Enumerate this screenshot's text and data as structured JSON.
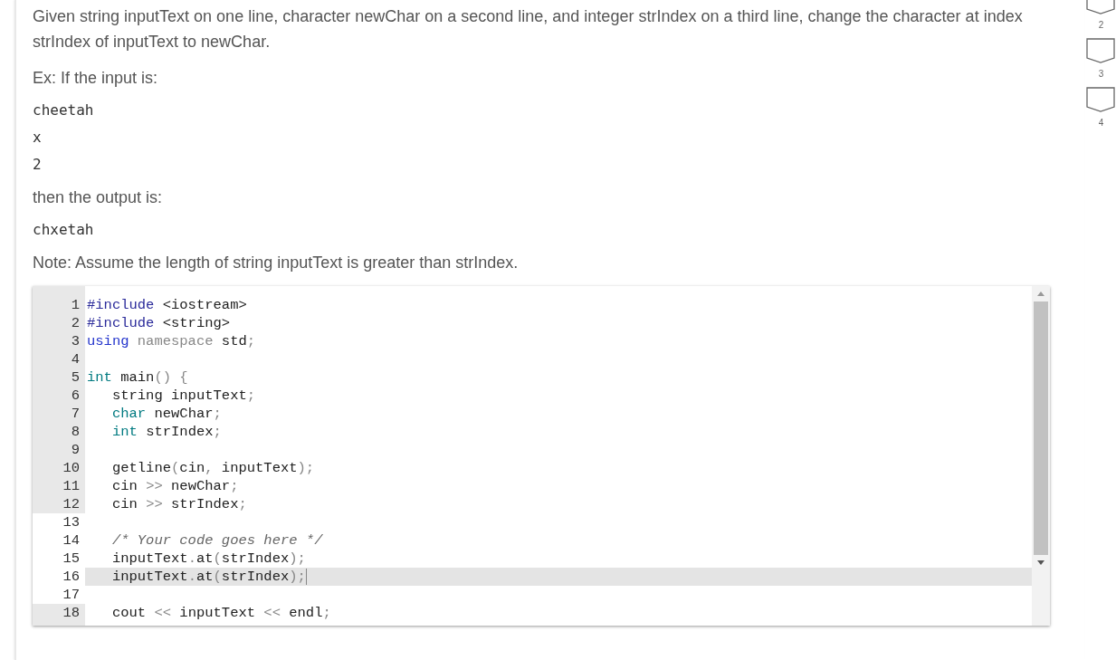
{
  "prompt": {
    "paragraphs": [
      {
        "kind": "text",
        "text": "Given string inputText on one line, character newChar on a second line, and integer strIndex on a third line, change the character at index strIndex of inputText to newChar."
      },
      {
        "kind": "text",
        "text": "Ex: If the input is:"
      },
      {
        "kind": "code",
        "text": "cheetah"
      },
      {
        "kind": "code",
        "text": "x"
      },
      {
        "kind": "code",
        "text": "2"
      },
      {
        "kind": "text",
        "text": "then the output is:"
      },
      {
        "kind": "code",
        "text": "chxetah"
      },
      {
        "kind": "text",
        "text": "Note: Assume the length of string inputText is greater than strIndex."
      }
    ]
  },
  "editor": {
    "lines": [
      {
        "number": "1",
        "read_only": true,
        "active": false,
        "tokens": [
          {
            "kind": "meta",
            "text": "#include "
          },
          {
            "kind": "plain",
            "text": "<iostream>"
          }
        ]
      },
      {
        "number": "2",
        "read_only": true,
        "active": false,
        "tokens": [
          {
            "kind": "meta",
            "text": "#include "
          },
          {
            "kind": "plain",
            "text": "<string>"
          }
        ]
      },
      {
        "number": "3",
        "read_only": true,
        "active": false,
        "tokens": [
          {
            "kind": "keyword",
            "text": "using "
          },
          {
            "kind": "muted",
            "text": "namespace "
          },
          {
            "kind": "plain",
            "text": "std"
          },
          {
            "kind": "punct",
            "text": ";"
          }
        ]
      },
      {
        "number": "4",
        "read_only": true,
        "active": false
      },
      {
        "number": "5",
        "read_only": true,
        "active": false,
        "tokens": [
          {
            "kind": "type",
            "text": "int "
          },
          {
            "kind": "plain",
            "text": "main"
          },
          {
            "kind": "punct",
            "text": "() {"
          }
        ]
      },
      {
        "number": "6",
        "read_only": true,
        "active": false,
        "tokens": [
          {
            "kind": "plain",
            "text": "   string inputText"
          },
          {
            "kind": "punct",
            "text": ";"
          }
        ]
      },
      {
        "number": "7",
        "read_only": true,
        "active": false,
        "tokens": [
          {
            "kind": "type",
            "text": "   char "
          },
          {
            "kind": "plain",
            "text": "newChar"
          },
          {
            "kind": "punct",
            "text": ";"
          }
        ]
      },
      {
        "number": "8",
        "read_only": true,
        "active": false,
        "tokens": [
          {
            "kind": "type",
            "text": "   int "
          },
          {
            "kind": "plain",
            "text": "strIndex"
          },
          {
            "kind": "punct",
            "text": ";"
          }
        ]
      },
      {
        "number": "9",
        "read_only": true,
        "active": false
      },
      {
        "number": "10",
        "read_only": true,
        "active": false,
        "tokens": [
          {
            "kind": "plain",
            "text": "   getline"
          },
          {
            "kind": "punct",
            "text": "("
          },
          {
            "kind": "plain",
            "text": "cin"
          },
          {
            "kind": "punct",
            "text": ", "
          },
          {
            "kind": "plain",
            "text": "inputText"
          },
          {
            "kind": "punct",
            "text": ");"
          }
        ]
      },
      {
        "number": "11",
        "read_only": true,
        "active": false,
        "tokens": [
          {
            "kind": "plain",
            "text": "   cin "
          },
          {
            "kind": "punct",
            "text": ">> "
          },
          {
            "kind": "plain",
            "text": "newChar"
          },
          {
            "kind": "punct",
            "text": ";"
          }
        ]
      },
      {
        "number": "12",
        "read_only": true,
        "active": false,
        "tokens": [
          {
            "kind": "plain",
            "text": "   cin "
          },
          {
            "kind": "punct",
            "text": ">> "
          },
          {
            "kind": "plain",
            "text": "strIndex"
          },
          {
            "kind": "punct",
            "text": ";"
          }
        ]
      },
      {
        "number": "13",
        "read_only": false,
        "active": false
      },
      {
        "number": "14",
        "read_only": false,
        "active": false,
        "tokens": [
          {
            "kind": "comment",
            "text": "   /* Your code goes here */"
          }
        ]
      },
      {
        "number": "15",
        "read_only": false,
        "active": false,
        "tokens": [
          {
            "kind": "plain",
            "text": "   inputText"
          },
          {
            "kind": "punct",
            "text": "."
          },
          {
            "kind": "plain",
            "text": "at"
          },
          {
            "kind": "punct",
            "text": "("
          },
          {
            "kind": "plain",
            "text": "strIndex"
          },
          {
            "kind": "punct",
            "text": ");"
          }
        ]
      },
      {
        "number": "16",
        "read_only": false,
        "active": true,
        "tokens": [
          {
            "kind": "plain",
            "text": "   inputText"
          },
          {
            "kind": "punct",
            "text": "."
          },
          {
            "kind": "plain",
            "text": "at"
          },
          {
            "kind": "punct",
            "text": "("
          },
          {
            "kind": "plain",
            "text": "strIndex"
          },
          {
            "kind": "punct",
            "text": ");"
          }
        ]
      },
      {
        "number": "17",
        "read_only": false,
        "active": false
      },
      {
        "number": "18",
        "read_only": true,
        "active": false,
        "tokens": [
          {
            "kind": "plain",
            "text": "   cout "
          },
          {
            "kind": "punct",
            "text": "<< "
          },
          {
            "kind": "plain",
            "text": "inputText "
          },
          {
            "kind": "punct",
            "text": "<< "
          },
          {
            "kind": "plain",
            "text": "endl"
          },
          {
            "kind": "punct",
            "text": ";"
          }
        ]
      }
    ]
  },
  "progress": [
    {
      "label": "2"
    },
    {
      "label": "3"
    },
    {
      "label": "4"
    }
  ]
}
